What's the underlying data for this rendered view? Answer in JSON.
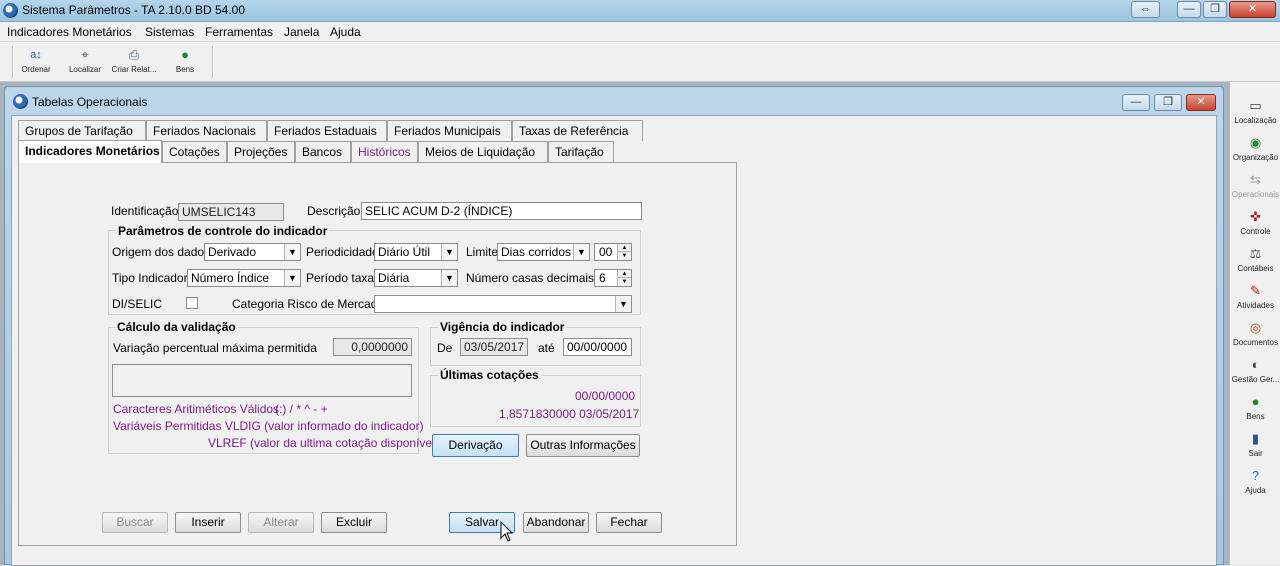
{
  "app": {
    "title": "Sistema Parâmetros -  TA 2.10.0 BD 54.00",
    "window_buttons": {
      "restore": "⇔",
      "minimize": "—",
      "maximize": "❐",
      "close": "✕"
    }
  },
  "menu": [
    "Indicadores Monetários",
    "Sistemas",
    "Ferramentas",
    "Janela",
    "Ajuda"
  ],
  "toolbar": [
    {
      "label": "Ordenar",
      "icon": "sort-icon"
    },
    {
      "label": "Localizar",
      "icon": "locate-icon"
    },
    {
      "label": "Criar Relat...",
      "icon": "printer-icon"
    },
    {
      "label": "Bens",
      "icon": "money-bag-icon"
    }
  ],
  "right_panel": [
    {
      "label": "Localização",
      "icon": "location-icon",
      "enabled": true
    },
    {
      "label": "Organização",
      "icon": "organization-icon",
      "enabled": true
    },
    {
      "label": "Operacionais",
      "icon": "operations-icon",
      "enabled": false
    },
    {
      "label": "Controle",
      "icon": "control-icon",
      "enabled": true
    },
    {
      "label": "Contábeis",
      "icon": "scale-icon",
      "enabled": true
    },
    {
      "label": "Atividades",
      "icon": "activities-icon",
      "enabled": true
    },
    {
      "label": "Documentos",
      "icon": "documents-icon",
      "enabled": true
    },
    {
      "label": "Gestão Ger...",
      "icon": "eye-icon",
      "enabled": true
    },
    {
      "label": "Bens",
      "icon": "money-bag-icon",
      "enabled": true
    },
    {
      "label": "Sair",
      "icon": "exit-icon",
      "enabled": true
    },
    {
      "label": "Ajuda",
      "icon": "help-icon",
      "enabled": true
    }
  ],
  "child_window": {
    "title": "Tabelas Operacionais",
    "tabs_row1": [
      "Grupos de Tarifação",
      "Feriados Nacionais",
      "Feriados Estaduais",
      "Feriados Municipais",
      "Taxas de Referência"
    ],
    "tabs_row2": [
      "Indicadores Monetários",
      "Cotações",
      "Projeções",
      "Bancos",
      "Históricos",
      "Meios de Liquidação",
      "Tarifação"
    ],
    "active_tab": "Indicadores Monetários"
  },
  "form": {
    "identificacao_label": "Identificação",
    "identificacao_value": "UMSELIC143",
    "descricao_label": "Descrição",
    "descricao_value": "SELIC ACUM D-2 (ÍNDICE)",
    "params_title": "Parâmetros de controle do indicador",
    "origem_label": "Origem dos dados",
    "origem_value": "Derivado",
    "periodicidade_label": "Periodicidade",
    "periodicidade_value": "Diário Útil",
    "limite_label": "Limite",
    "limite_value": "Dias corridos",
    "limite_num": "00",
    "tipo_label": "Tipo Indicador",
    "tipo_value": "Número Índice",
    "periodo_label": "Período taxa",
    "periodo_value": "Diária",
    "casas_label": "Número casas decimais",
    "casas_value": "6",
    "diselic_label": "DI/SELIC",
    "categoria_label": "Categoria Risco de Mercado",
    "categoria_value": "",
    "calc_title": "Cálculo da validação",
    "variacao_label": "Variação percentual máxima permitida",
    "variacao_value": "0,0000000",
    "caracteres_label": "Caracteres Aritiméticos Válidos:",
    "caracteres_value": "( ) / * ^ - +",
    "variaveis_text": "Variáveis Permitidas VLDIG  (valor informado do indicador)",
    "vlref_text": "VLREF (valor da ultima cotação disponível)",
    "vigencia_title": "Vigência do indicador",
    "de_label": "De",
    "de_value": "03/05/2017",
    "ate_label": "até",
    "ate_value": "00/00/0000",
    "ultimas_title": "Últimas cotações",
    "cotacao1": "00/00/0000",
    "cotacao2": "1,8571830000  03/05/2017",
    "derivacao_button": "Derivação",
    "outras_button": "Outras Informações"
  },
  "actions": {
    "buscar": "Buscar",
    "inserir": "Inserir",
    "alterar": "Alterar",
    "excluir": "Excluir",
    "salvar": "Salvar",
    "abandonar": "Abandonar",
    "fechar": "Fechar"
  },
  "colors": {
    "accent_purple": "#7a1f86",
    "title_bar": "#9cc3de",
    "close_red": "#c8412e"
  }
}
